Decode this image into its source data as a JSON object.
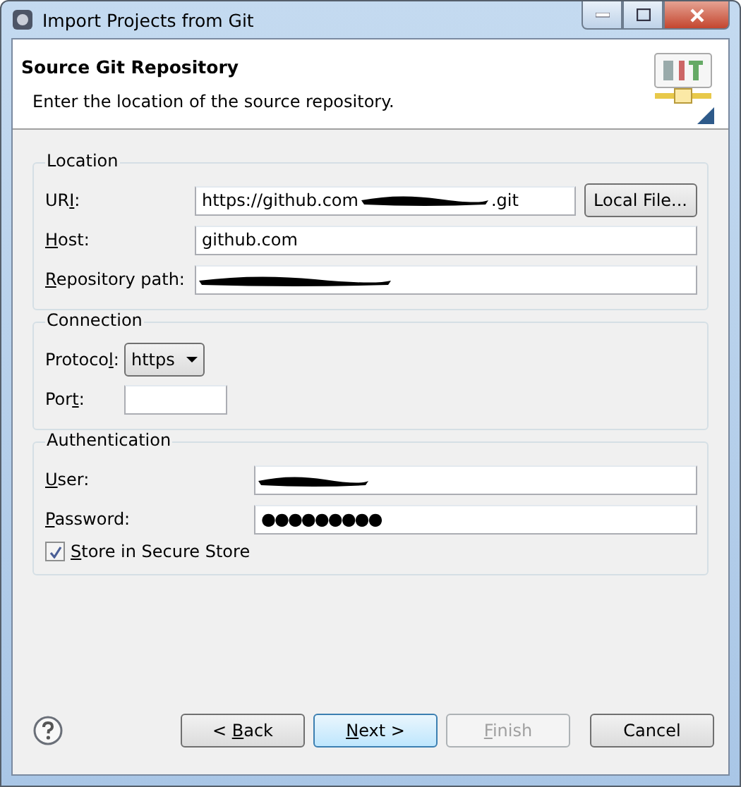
{
  "window": {
    "title": "Import Projects from Git"
  },
  "header": {
    "title": "Source Git Repository",
    "description": "Enter the location of the source repository."
  },
  "location": {
    "title": "Location",
    "uri": {
      "label": {
        "pre": "UR",
        "key": "I",
        "post": ":"
      },
      "value_start": "https://github.com",
      "value_end": ".git",
      "redacted": true
    },
    "local_file_button": "Local File...",
    "host": {
      "label": {
        "key": "H",
        "post": "ost:"
      },
      "value": "github.com"
    },
    "repository_path": {
      "label": {
        "key": "R",
        "post": "epository path:"
      },
      "redacted": true
    }
  },
  "connection": {
    "title": "Connection",
    "protocol": {
      "label": {
        "pre": "Protoco",
        "key": "l",
        "post": ":"
      },
      "value": "https"
    },
    "port": {
      "label": {
        "pre": "Por",
        "key": "t",
        "post": ":"
      }
    }
  },
  "authentication": {
    "title": "Authentication",
    "user": {
      "label": {
        "key": "U",
        "post": "ser:"
      },
      "redacted": true
    },
    "password": {
      "label": {
        "key": "P",
        "post": "assword:"
      },
      "value": "●●●●●●●●●"
    },
    "store": {
      "label": {
        "key": "S",
        "post": "tore in Secure Store"
      },
      "checked": true
    }
  },
  "buttons": [
    {
      "label": {
        "pre": "< ",
        "key": "B",
        "post": "ack"
      },
      "disabled": false,
      "default": false
    },
    {
      "label": {
        "key": "N",
        "post": "ext >"
      },
      "disabled": false,
      "default": true
    },
    {
      "label": {
        "key": "F",
        "post": "inish"
      },
      "disabled": true,
      "default": false
    },
    {
      "label": {
        "pre": "Cancel"
      },
      "disabled": false,
      "default": false
    }
  ]
}
